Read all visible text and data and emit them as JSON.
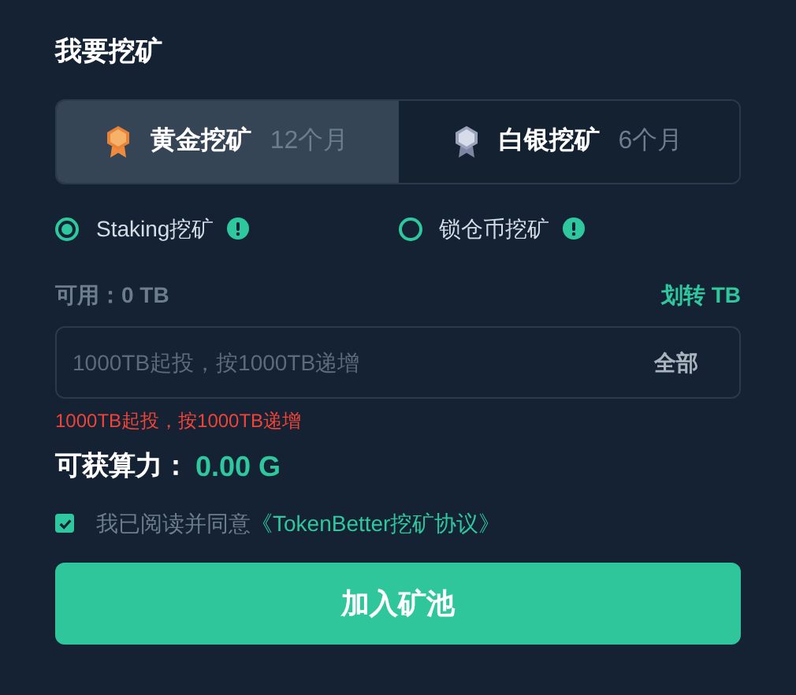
{
  "title": "我要挖矿",
  "tabs": [
    {
      "kind": "gold",
      "label": "黄金挖矿",
      "period": "12个月",
      "selected": true
    },
    {
      "kind": "silver",
      "label": "白银挖矿",
      "period": "6个月",
      "selected": false
    }
  ],
  "modes": [
    {
      "label": "Staking挖矿",
      "selected": true
    },
    {
      "label": "锁仓币挖矿",
      "selected": false
    }
  ],
  "available": "可用：0 TB",
  "transfer_link": "划转 TB",
  "amount_field": {
    "placeholder": "1000TB起投，按1000TB递增",
    "all_button": "全部"
  },
  "error": "1000TB起投，按1000TB递增",
  "hashrate": {
    "label": "可获算力：",
    "value": "0.00 G"
  },
  "agreement": {
    "checked": true,
    "text": "我已阅读并同意",
    "link": "《TokenBetter挖矿协议》"
  },
  "submit": "加入矿池"
}
